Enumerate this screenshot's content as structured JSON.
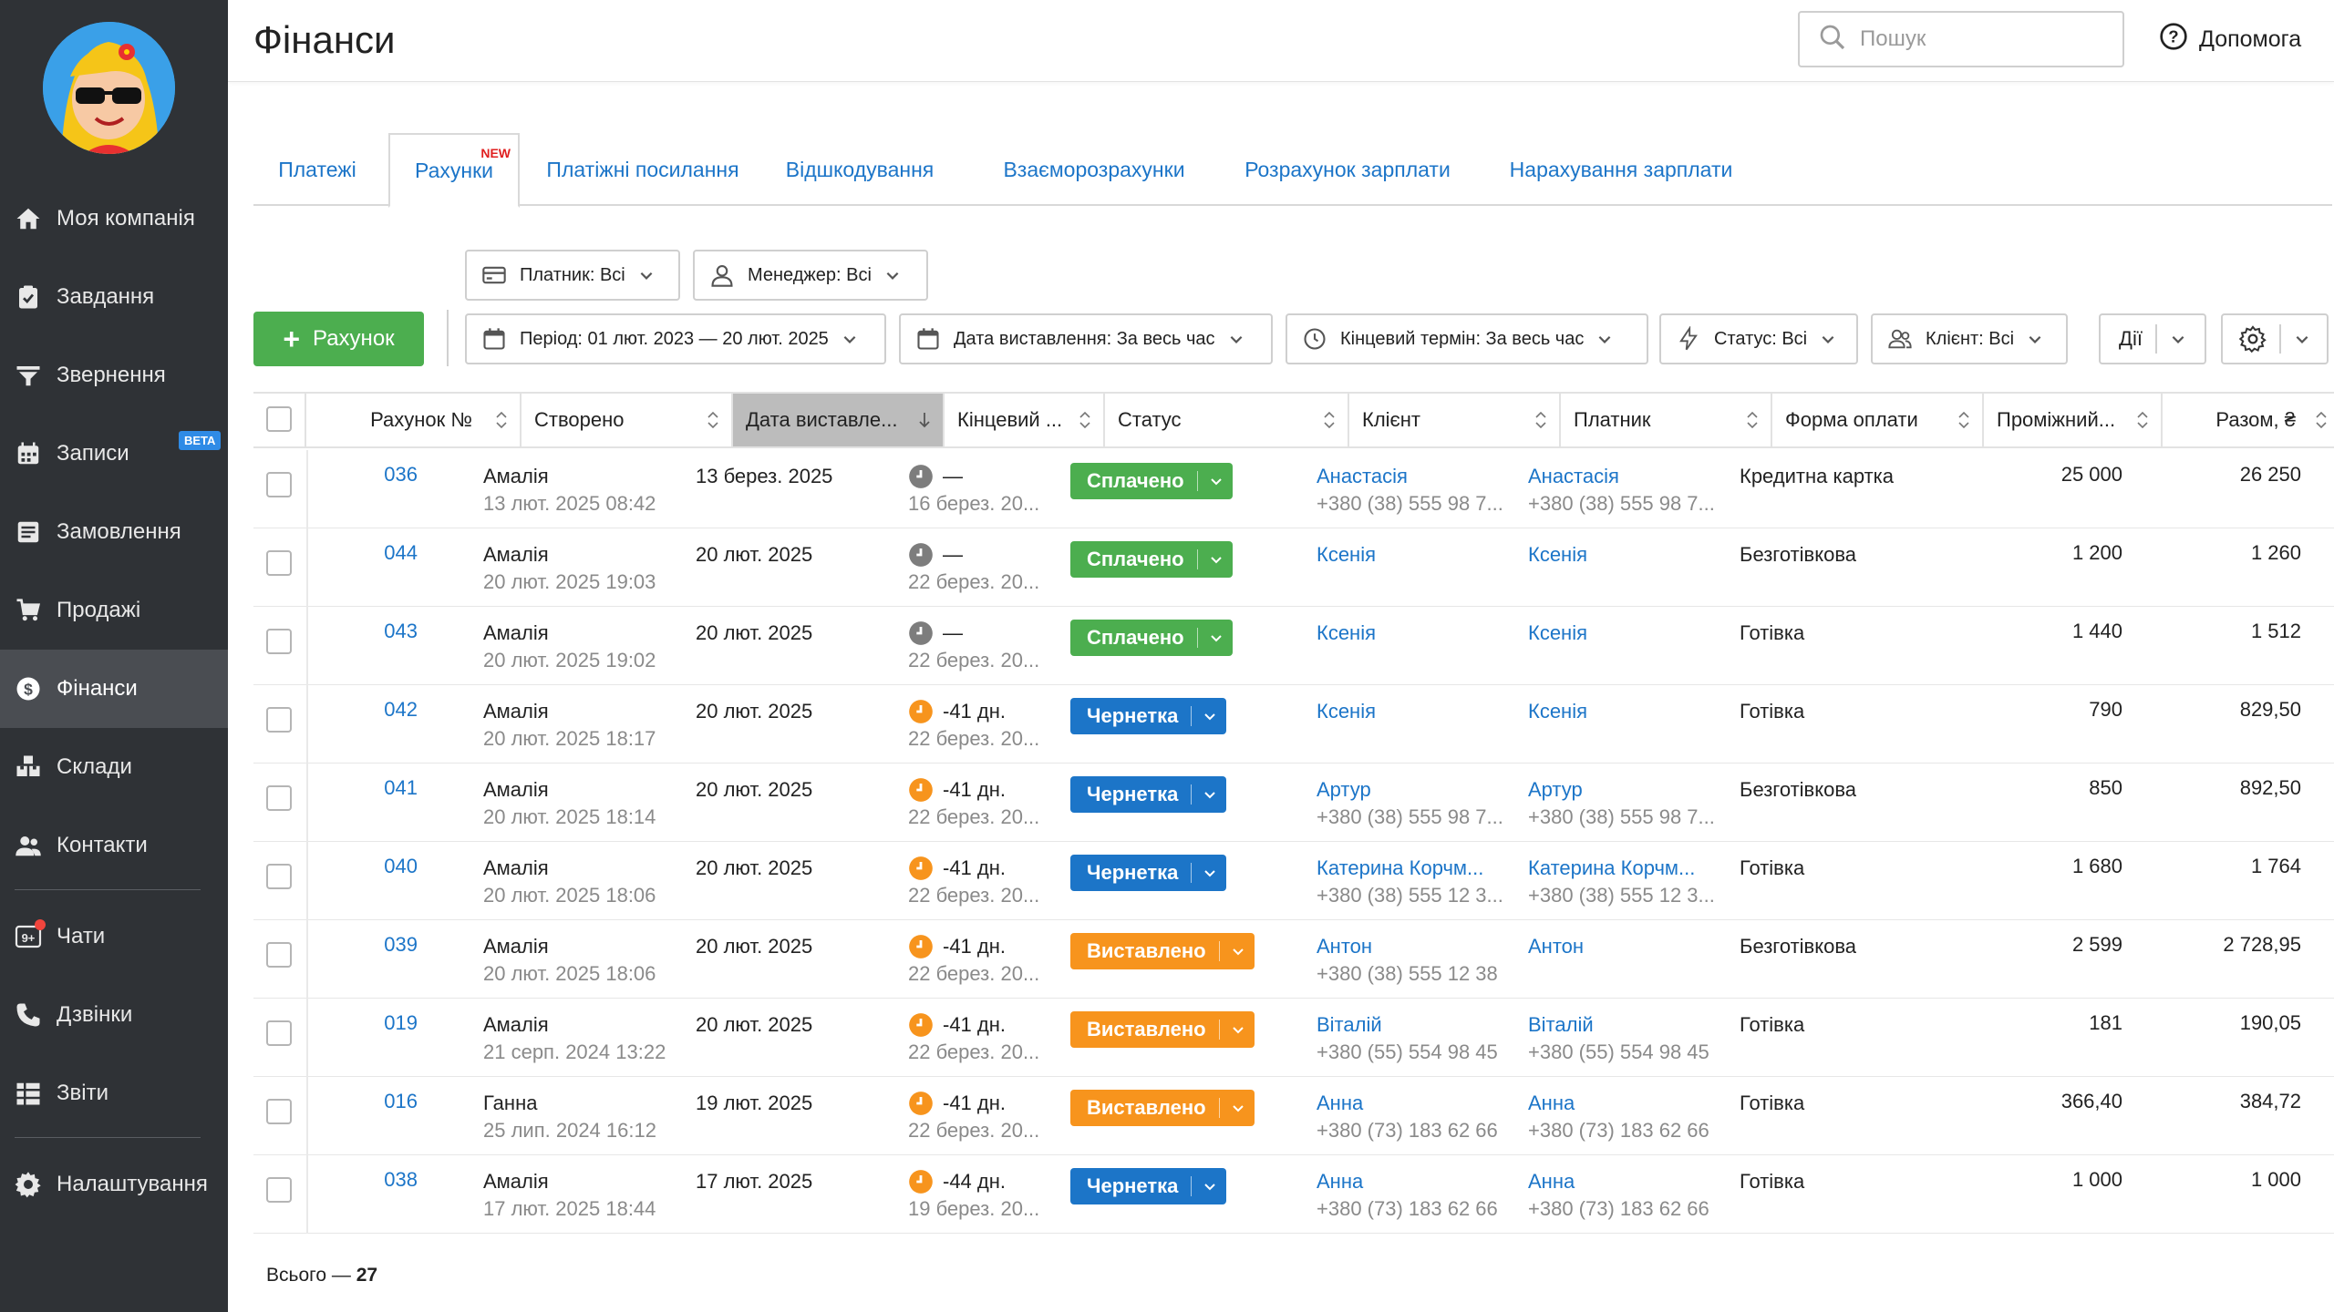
{
  "sidebar": {
    "items": [
      {
        "label": "Моя компанія",
        "icon": "home-icon"
      },
      {
        "label": "Завдання",
        "icon": "clipboard-check-icon"
      },
      {
        "label": "Звернення",
        "icon": "funnel-icon"
      },
      {
        "label": "Записи",
        "icon": "calendar-icon",
        "badge": "BETA"
      },
      {
        "label": "Замовлення",
        "icon": "order-list-icon"
      },
      {
        "label": "Продажі",
        "icon": "cart-icon"
      },
      {
        "label": "Фінанси",
        "icon": "dollar-circle-icon",
        "active": true
      },
      {
        "label": "Склади",
        "icon": "warehouse-boxes-icon"
      },
      {
        "label": "Контакти",
        "icon": "contacts-icon"
      },
      {
        "label": "Чати",
        "icon": "chat-badge-icon",
        "icon_text": "9+"
      },
      {
        "label": "Дзвінки",
        "icon": "phone-icon"
      },
      {
        "label": "Звіти",
        "icon": "reports-icon"
      },
      {
        "label": "Налаштування",
        "icon": "gear-icon"
      }
    ]
  },
  "header": {
    "title": "Фінанси",
    "search_placeholder": "Пошук",
    "help_label": "Допомога"
  },
  "tabs": [
    {
      "label": "Платежі"
    },
    {
      "label": "Рахунки",
      "active": true,
      "badge": "NEW"
    },
    {
      "label": "Платіжні посилання"
    },
    {
      "label": "Відшкодування"
    },
    {
      "label": "Взаєморозрахунки"
    },
    {
      "label": "Розрахунок зарплати"
    },
    {
      "label": "Нарахування зарплати"
    }
  ],
  "filters": {
    "payer": "Платник: Всі",
    "manager": "Менеджер: Всі",
    "add_button": "Рахунок",
    "period": "Період: 01 лют. 2023 — 20 лют. 2025",
    "issue_date": "Дата виставлення: За весь час",
    "deadline": "Кінцевий термін: За весь час",
    "status": "Статус: Всі",
    "client": "Клієнт: Всі",
    "actions": "Дії"
  },
  "table": {
    "columns": [
      "Рахунок №",
      "Створено",
      "Дата виставле...",
      "Кінцевий ...",
      "Статус",
      "Клієнт",
      "Платник",
      "Форма оплати",
      "Проміжний...",
      "Разом, ₴"
    ],
    "rows": [
      {
        "num": "036",
        "creator": "Амалія",
        "created": "13 лют. 2025 08:42",
        "issued": "13 берез. 2025",
        "deadline": "—",
        "deadline_sub": "16 берез. 20...",
        "deadline_state": "grey",
        "status": "Сплачено",
        "status_color": "#4cae4f",
        "client": "Анастасія",
        "client_phone": "+380 (38) 555 98 7...",
        "payer": "Анастасія",
        "payer_phone": "+380 (38) 555 98 7...",
        "payment": "Кредитна картка",
        "subtotal": "25 000",
        "total": "26 250"
      },
      {
        "num": "044",
        "creator": "Амалія",
        "created": "20 лют. 2025 19:03",
        "issued": "20 лют. 2025",
        "deadline": "—",
        "deadline_sub": "22 берез. 20...",
        "deadline_state": "grey",
        "status": "Сплачено",
        "status_color": "#4cae4f",
        "client": "Ксенія",
        "client_phone": "",
        "payer": "Ксенія",
        "payer_phone": "",
        "payment": "Безготівкова",
        "subtotal": "1 200",
        "total": "1 260"
      },
      {
        "num": "043",
        "creator": "Амалія",
        "created": "20 лют. 2025 19:02",
        "issued": "20 лют. 2025",
        "deadline": "—",
        "deadline_sub": "22 берез. 20...",
        "deadline_state": "grey",
        "status": "Сплачено",
        "status_color": "#4cae4f",
        "client": "Ксенія",
        "client_phone": "",
        "payer": "Ксенія",
        "payer_phone": "",
        "payment": "Готівка",
        "subtotal": "1 440",
        "total": "1 512"
      },
      {
        "num": "042",
        "creator": "Амалія",
        "created": "20 лют. 2025 18:17",
        "issued": "20 лют. 2025",
        "deadline": "-41 дн.",
        "deadline_sub": "22 берез. 20...",
        "deadline_state": "orange",
        "status": "Чернетка",
        "status_color": "#1c75c8",
        "client": "Ксенія",
        "client_phone": "",
        "payer": "Ксенія",
        "payer_phone": "",
        "payment": "Готівка",
        "subtotal": "790",
        "total": "829,50"
      },
      {
        "num": "041",
        "creator": "Амалія",
        "created": "20 лют. 2025 18:14",
        "issued": "20 лют. 2025",
        "deadline": "-41 дн.",
        "deadline_sub": "22 берез. 20...",
        "deadline_state": "orange",
        "status": "Чернетка",
        "status_color": "#1c75c8",
        "client": "Артур",
        "client_phone": "+380 (38) 555 98 7...",
        "payer": "Артур",
        "payer_phone": "+380 (38) 555 98 7...",
        "payment": "Безготівкова",
        "subtotal": "850",
        "total": "892,50"
      },
      {
        "num": "040",
        "creator": "Амалія",
        "created": "20 лют. 2025 18:06",
        "issued": "20 лют. 2025",
        "deadline": "-41 дн.",
        "deadline_sub": "22 берез. 20...",
        "deadline_state": "orange",
        "status": "Чернетка",
        "status_color": "#1c75c8",
        "client": "Катерина Корчм...",
        "client_phone": "+380 (38) 555 12 3...",
        "payer": "Катерина Корчм...",
        "payer_phone": "+380 (38) 555 12 3...",
        "payment": "Готівка",
        "subtotal": "1 680",
        "total": "1 764"
      },
      {
        "num": "039",
        "creator": "Амалія",
        "created": "20 лют. 2025 18:06",
        "issued": "20 лют. 2025",
        "deadline": "-41 дн.",
        "deadline_sub": "22 берез. 20...",
        "deadline_state": "orange",
        "status": "Виставлено",
        "status_color": "#f7941d",
        "client": "Антон",
        "client_phone": "+380 (38) 555 12 38",
        "payer": "Антон",
        "payer_phone": "",
        "payment": "Безготівкова",
        "subtotal": "2 599",
        "total": "2 728,95"
      },
      {
        "num": "019",
        "creator": "Амалія",
        "created": "21 серп. 2024 13:22",
        "issued": "20 лют. 2025",
        "deadline": "-41 дн.",
        "deadline_sub": "22 берез. 20...",
        "deadline_state": "orange",
        "status": "Виставлено",
        "status_color": "#f7941d",
        "client": "Віталій",
        "client_phone": "+380 (55) 554 98 45",
        "payer": "Віталій",
        "payer_phone": "+380 (55) 554 98 45",
        "payment": "Готівка",
        "subtotal": "181",
        "total": "190,05"
      },
      {
        "num": "016",
        "creator": "Ганна",
        "created": "25 лип. 2024 16:12",
        "issued": "19 лют. 2025",
        "deadline": "-41 дн.",
        "deadline_sub": "22 берез. 20...",
        "deadline_state": "orange",
        "status": "Виставлено",
        "status_color": "#f7941d",
        "client": "Анна",
        "client_phone": "+380 (73) 183 62 66",
        "payer": "Анна",
        "payer_phone": "+380 (73) 183 62 66",
        "payment": "Готівка",
        "subtotal": "366,40",
        "total": "384,72"
      },
      {
        "num": "038",
        "creator": "Амалія",
        "created": "17 лют. 2025 18:44",
        "issued": "17 лют. 2025",
        "deadline": "-44 дн.",
        "deadline_sub": "19 берез. 20...",
        "deadline_state": "orange",
        "status": "Чернетка",
        "status_color": "#1c75c8",
        "client": "Анна",
        "client_phone": "+380 (73) 183 62 66",
        "payer": "Анна",
        "payer_phone": "+380 (73) 183 62 66",
        "payment": "Готівка",
        "subtotal": "1 000",
        "total": "1 000"
      }
    ]
  },
  "footer": {
    "total_label": "Всього —",
    "total_count": "27"
  }
}
